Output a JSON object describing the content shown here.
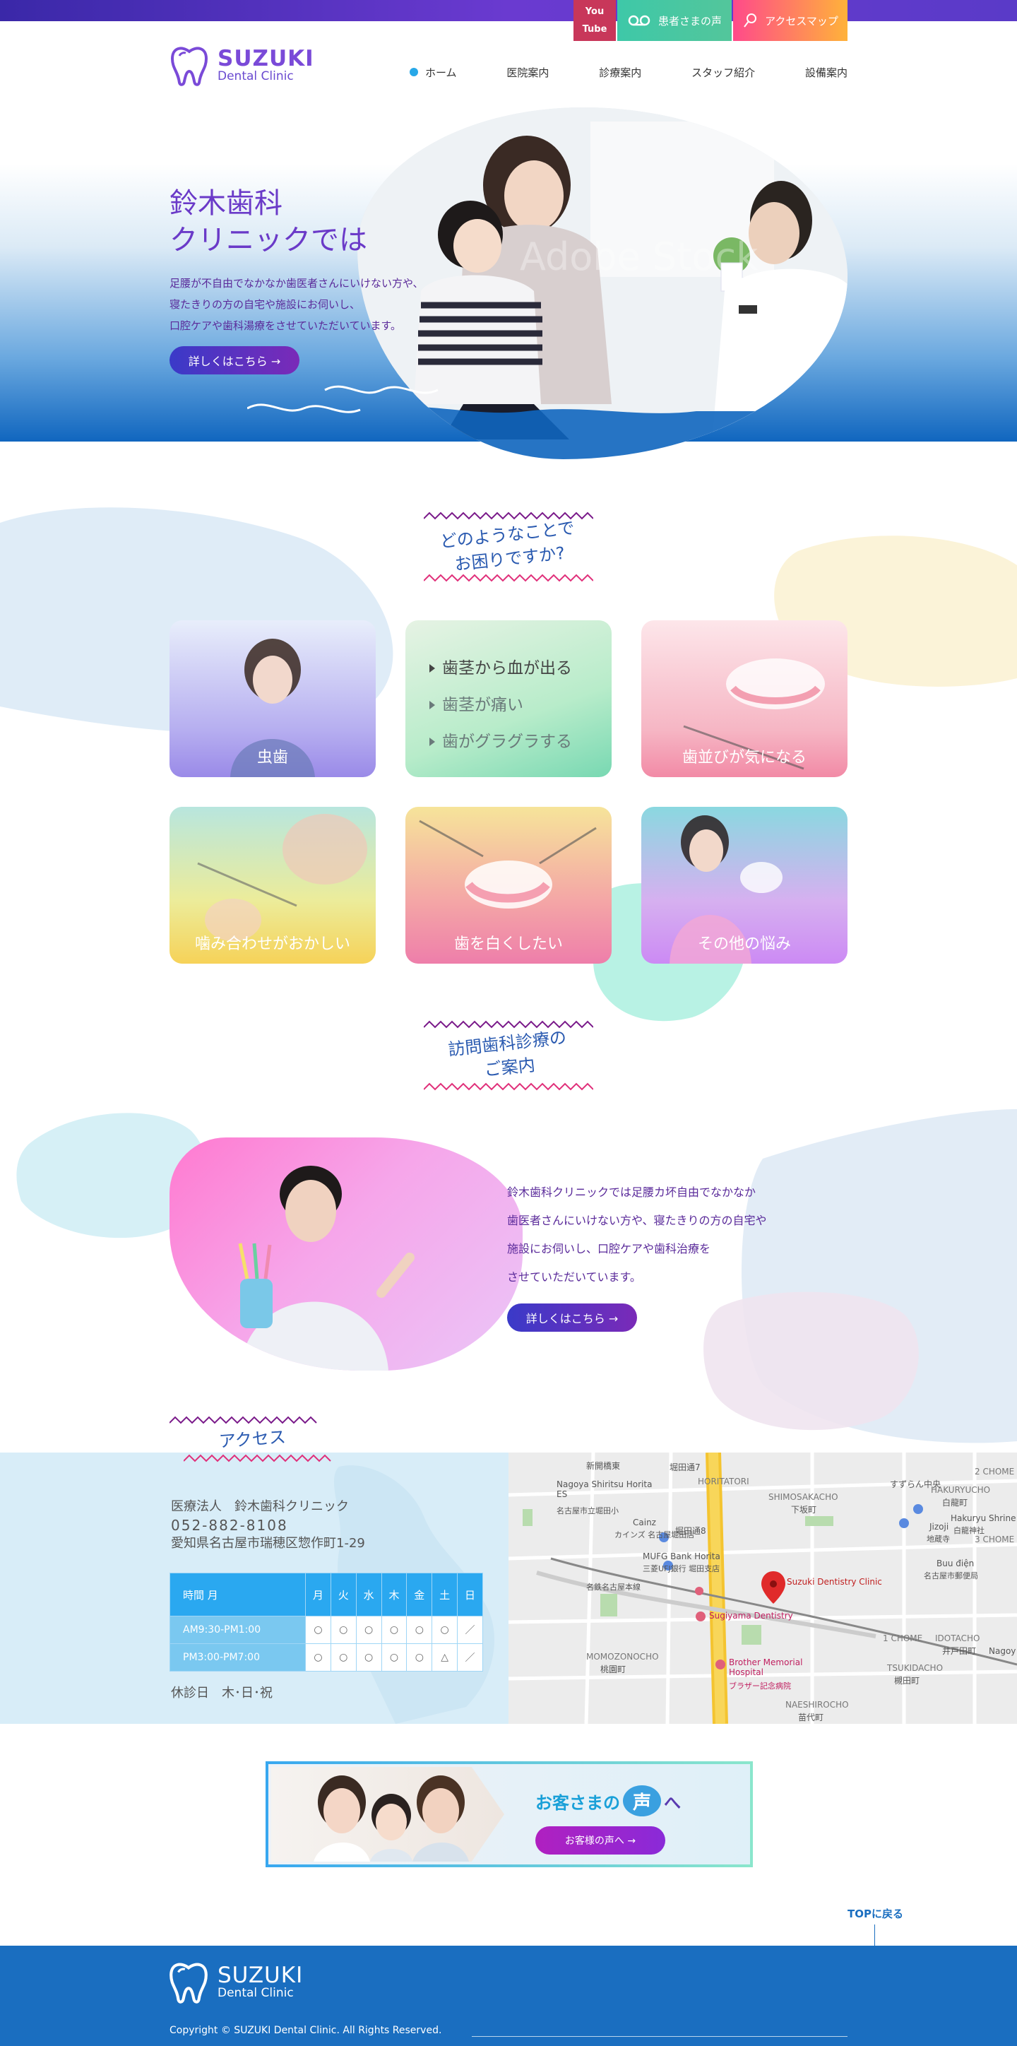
{
  "topbar": {
    "youtube_top": "You",
    "youtube_bottom": "Tube",
    "voice_label": "患者さまの声",
    "map_label": "アクセスマップ"
  },
  "brand": {
    "name": "SUZUKI",
    "sub": "Dental Clinic"
  },
  "nav": [
    {
      "label": "ホーム"
    },
    {
      "label": "医院案内"
    },
    {
      "label": "診療案内"
    },
    {
      "label": "スタッフ紹介"
    },
    {
      "label": "設備案内"
    }
  ],
  "hero": {
    "title_line1": "鈴木歯科",
    "title_line2": "クリニックでは",
    "text_line1": "足腰が不自由でなかなか歯医者さんにいけない方や、",
    "text_line2": "寝たきりの方の自宅や施設にお伺いし、",
    "text_line3": "口腔ケアや歯科湯療をさせていただいています。",
    "button": "詳しくはこちら →",
    "watermark": "Adobe Stock"
  },
  "problems": {
    "heading_line1": "どのようなことで",
    "heading_line2": "お困りですか?",
    "cards": [
      {
        "label": "虫歯"
      },
      {
        "label": ""
      },
      {
        "label": "歯並びが気になる"
      },
      {
        "label": "噛み合わせがおかしい"
      },
      {
        "label": "歯を白くしたい"
      },
      {
        "label": "その他の悩み"
      }
    ],
    "symptoms": [
      "歯茎から血が出る",
      "歯茎が痛い",
      "歯がグラグラする"
    ]
  },
  "visit": {
    "heading_line1": "訪問歯科診療の",
    "heading_line2": "ご案内",
    "text_line1": "鈴木歯科クリニックでは足腰カ坏自由でなかなか",
    "text_line2": "歯医者さんにいけない方や、寝たきりの方の自宅や",
    "text_line3": "施設にお伺いし、口腔ケアや歯科治療を",
    "text_line4": "させていただいています。",
    "button": "詳しくはこちら →"
  },
  "access": {
    "heading": "アクセス",
    "clinic_name": "医療法人　鈴木歯科クリニック",
    "phone": "052-882-8108",
    "address": "愛知県名古屋市瑞穂区惣作町1-29",
    "table": {
      "header": [
        "時間 月",
        "月",
        "火",
        "水",
        "木",
        "金",
        "土",
        "日"
      ],
      "rows": [
        {
          "time": "AM9:30-PM1:00",
          "marks": [
            "○",
            "○",
            "○",
            "○",
            "○",
            "○",
            "／"
          ]
        },
        {
          "time": "PM3:00-PM7:00",
          "marks": [
            "○",
            "○",
            "○",
            "○",
            "○",
            "△",
            "／"
          ]
        }
      ]
    },
    "closed": "休診日　木･日･祝"
  },
  "map": {
    "labels": [
      "新開橋東",
      "堀田通7",
      "HORITATORI",
      "SHIMOSAKACHO",
      "下坂町",
      "Nagoya Shiritsu Horita ES",
      "名古屋市立堀田小",
      "Cainz",
      "カインズ 名古屋堀田店",
      "堀田通8",
      "MUFG Bank Horita",
      "三菱UFJ銀行 堀田支店",
      "Suzuki Dentistry Clinic",
      "名鉄名古屋本線",
      "Sugiyama Dentistry",
      "MOMOZONOCHO",
      "桃園町",
      "Brother Memorial Hospital",
      "ブラザー記念病院",
      "NAESHIROCHO",
      "苗代町",
      "HAKURYUCHO",
      "白龍町",
      "Hakuryu Shrine",
      "白龍神社",
      "Jizoji",
      "地蔵寺",
      "Buu điện",
      "名古屋市郵便局",
      "IDOTACHO",
      "井戸田町",
      "TSUKIDACHO",
      "槻田町",
      "1 CHOME",
      "2 CHOME",
      "3 CHOME",
      "すずらん中央",
      "Nagoy"
    ]
  },
  "voice_banner": {
    "title_left": "お客さまの",
    "title_bubble": "声",
    "title_right": "へ",
    "button": "お客様の声へ →"
  },
  "totop": "TOPに戻る",
  "footer": {
    "name": "SUZUKI",
    "sub": "Dental Clinic",
    "copyright": "Copyright © SUZUKI Dental Clinic. All Rights Reserved."
  },
  "colors": {
    "accent_purple": "#6a3ac8",
    "accent_blue": "#1a6ec0",
    "table_blue": "#2aa8f0"
  }
}
